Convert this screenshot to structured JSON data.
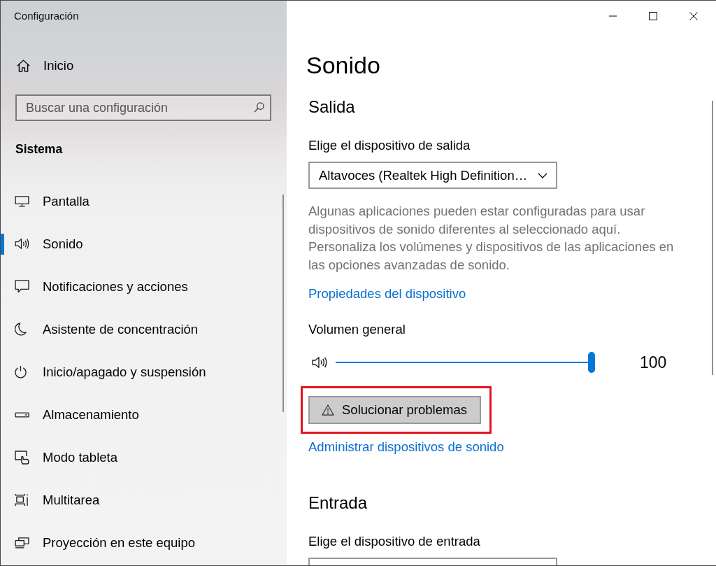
{
  "window": {
    "title": "Configuración"
  },
  "sidebar": {
    "home": {
      "label": "Inicio"
    },
    "search": {
      "placeholder": "Buscar una configuración"
    },
    "section_title": "Sistema",
    "items": [
      {
        "label": "Pantalla",
        "selected": false
      },
      {
        "label": "Sonido",
        "selected": true
      },
      {
        "label": "Notificaciones y acciones",
        "selected": false
      },
      {
        "label": "Asistente de concentración",
        "selected": false
      },
      {
        "label": "Inicio/apagado y suspensión",
        "selected": false
      },
      {
        "label": "Almacenamiento",
        "selected": false
      },
      {
        "label": "Modo tableta",
        "selected": false
      },
      {
        "label": "Multitarea",
        "selected": false
      },
      {
        "label": "Proyección en este equipo",
        "selected": false
      }
    ]
  },
  "page": {
    "title": "Sonido",
    "sections": [
      {
        "heading": "Salida",
        "device_label": "Elige el dispositivo de salida",
        "device": "Altavoces (Realtek High Definition…",
        "note": "Algunas aplicaciones pueden estar configuradas para usar dispositivos de sonido diferentes al seleccionado aquí. Personaliza los volúmenes y dispositivos de las aplicaciones en las opciones avanzadas de sonido.",
        "properties_link": "Propiedades del dispositivo",
        "volume_label": "Volumen general",
        "volume": {
          "level": 1,
          "reading": "100"
        },
        "troubleshoot_button": {
          "label": "Solucionar problemas",
          "highlighted": true
        },
        "manage_link": "Administrar dispositivos de sonido"
      },
      {
        "heading": "Entrada",
        "device_label": "Elige el dispositivo de entrada"
      }
    ]
  }
}
